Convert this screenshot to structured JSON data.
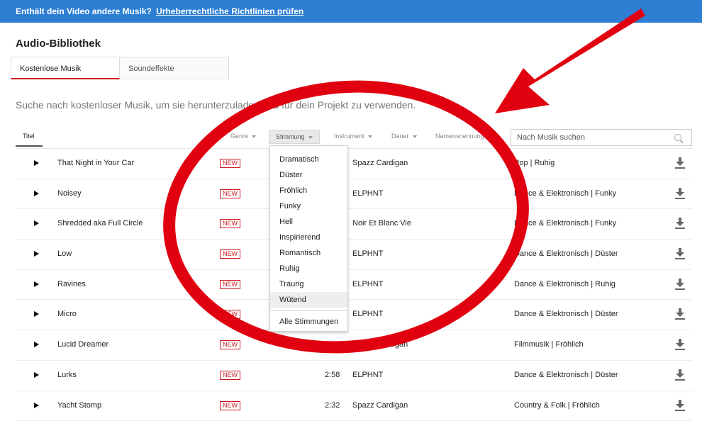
{
  "banner": {
    "text": "Enthält dein Video andere Musik?",
    "link": "Urheberrechtliche Richtlinien prüfen"
  },
  "page_title": "Audio-Bibliothek",
  "tabs": [
    {
      "label": "Kostenlose Musik",
      "active": true
    },
    {
      "label": "Soundeffekte",
      "active": false
    }
  ],
  "intro": "Suche nach kostenloser Musik, um sie herunterzuladen und für dein Projekt zu verwenden.",
  "filters": {
    "titel": "Titel",
    "genre": "Genre",
    "stimmung": "Stimmung",
    "instrument": "Instrument",
    "dauer": "Dauer",
    "namensnennung": "Namensnennung",
    "search_placeholder": "Nach Musik suchen"
  },
  "mood_dropdown": {
    "options": [
      "Dramatisch",
      "Düster",
      "Fröhlich",
      "Funky",
      "Hell",
      "Inspirierend",
      "Romantisch",
      "Ruhig",
      "Traurig",
      "Wütend"
    ],
    "highlighted": "Wütend",
    "all_label": "Alle Stimmungen"
  },
  "badge_label": "NEW",
  "tracks": [
    {
      "title": "That Night in Your Car",
      "duration": "",
      "artist": "Spazz Cardigan",
      "genre": "Pop | Ruhig"
    },
    {
      "title": "Noisey",
      "duration": "",
      "artist": "ELPHNT",
      "genre": "Dance & Elektronisch | Funky"
    },
    {
      "title": "Shredded aka Full Circle",
      "duration": "",
      "artist": "Noir Et Blanc Vie",
      "genre": "Dance & Elektronisch | Funky"
    },
    {
      "title": "Low",
      "duration": "",
      "artist": "ELPHNT",
      "genre": "Dance & Elektronisch | Düster"
    },
    {
      "title": "Ravines",
      "duration": "",
      "artist": "ELPHNT",
      "genre": "Dance & Elektronisch | Ruhig"
    },
    {
      "title": "Micro",
      "duration": "",
      "artist": "ELPHNT",
      "genre": "Dance & Elektronisch | Düster"
    },
    {
      "title": "Lucid Dreamer",
      "duration": "",
      "artist": "Spazz Cardigan",
      "genre": "Filmmusik | Fröhlich"
    },
    {
      "title": "Lurks",
      "duration": "2:58",
      "artist": "ELPHNT",
      "genre": "Dance & Elektronisch | Düster"
    },
    {
      "title": "Yacht Stomp",
      "duration": "2:32",
      "artist": "Spazz Cardigan",
      "genre": "Country & Folk | Fröhlich"
    }
  ],
  "colors": {
    "banner": "#2e7fd4",
    "accent_red": "#cc181e",
    "annotation_red": "#e0000f"
  },
  "icons": {
    "play": "play-icon",
    "download": "download-icon",
    "search": "search-icon",
    "caret": "caret-down-icon"
  }
}
